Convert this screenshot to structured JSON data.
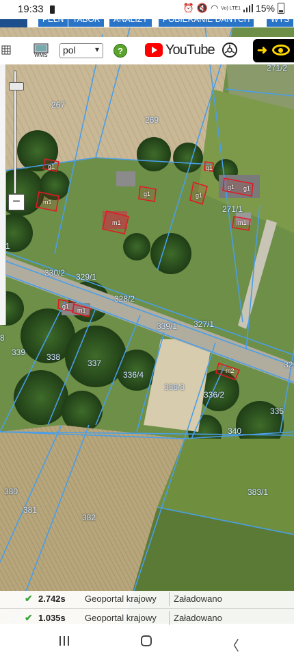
{
  "status_bar": {
    "time": "19:33",
    "battery_percent": "15%",
    "network_label": "Vo) LTE1"
  },
  "top_menu": {
    "tabs": [
      "PEŁN",
      "TABOR",
      "ANALIZY",
      "POBIERANIE DANYCH",
      "WYS"
    ]
  },
  "toolbar": {
    "wms_label": "WMS",
    "language_value": "pol",
    "language_chevron": "▾",
    "help_label": "?",
    "youtube_text": "YouTube",
    "eye_arrow": "➜"
  },
  "zoom": {
    "out_label": "−",
    "in_label": "+",
    "level": 0.1
  },
  "parcels": [
    "267",
    "269",
    "271/2",
    "271/1",
    "330/2",
    "329/1",
    "328/2",
    "339/1",
    "327/1",
    "339",
    "338",
    "337",
    "336/4",
    "336/3",
    "336/2",
    "335",
    "340",
    "383/1",
    "380",
    "381",
    "382",
    "1",
    "8",
    "32"
  ],
  "buildings": [
    "g1",
    "m1",
    "m1",
    "g1",
    "g1",
    "g1",
    "g1",
    "g1",
    "m1",
    "g1",
    "m1",
    "m2"
  ],
  "log": [
    {
      "time": "2.742s",
      "source": "Geoportal krajowy",
      "status": "Załadowano"
    },
    {
      "time": "1.035s",
      "source": "Geoportal krajowy",
      "status": "Załadowano"
    }
  ],
  "colors": {
    "parcel_line": "#4a9ee8",
    "building_line": "#e01b24",
    "help_green": "#5aa42c",
    "youtube_red": "#ff0000",
    "eye_yellow": "#ffd800"
  },
  "icons": [
    "grid-icon",
    "wms-icon",
    "help-icon",
    "youtube-logo-icon",
    "steering-wheel-icon",
    "arrow-icon",
    "eye-icon",
    "check-icon",
    "recent-apps-icon",
    "home-icon",
    "back-icon"
  ]
}
